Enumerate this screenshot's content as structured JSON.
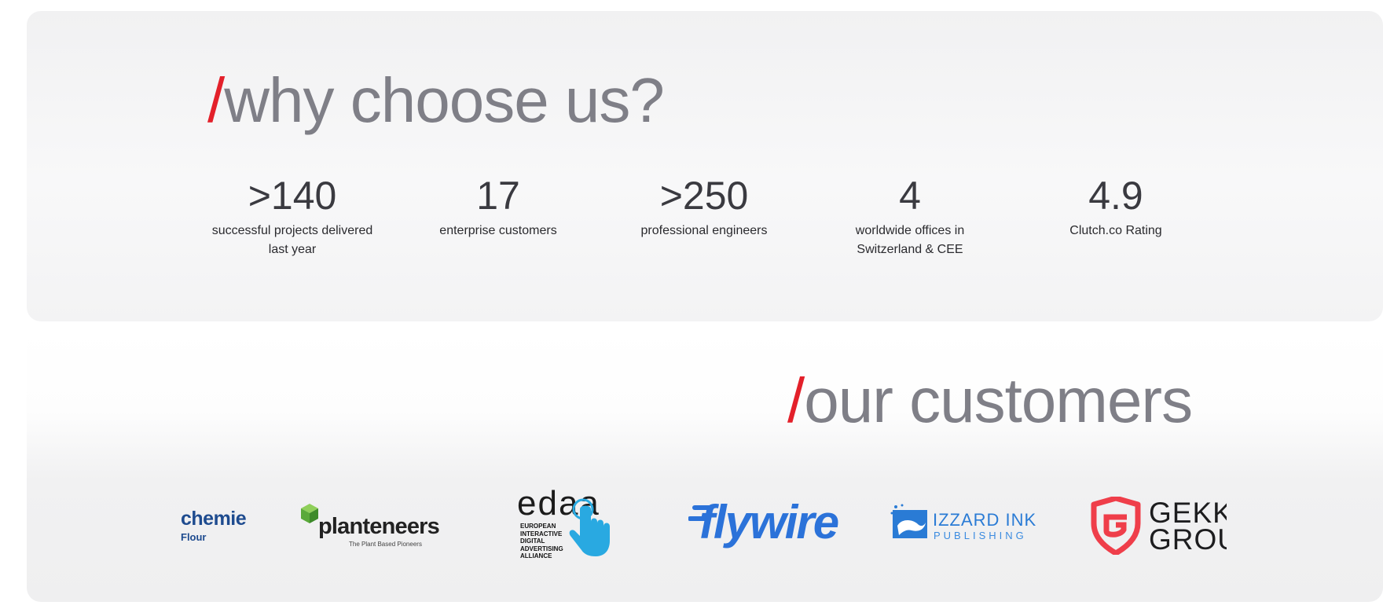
{
  "why": {
    "slash": "/",
    "title": "why choose us?"
  },
  "stats": [
    {
      "value": ">140",
      "label_line1": "successful projects delivered",
      "label_line2": "last year"
    },
    {
      "value": "17",
      "label_line1": "enterprise customers",
      "label_line2": ""
    },
    {
      "value": ">250",
      "label_line1": "professional engineers",
      "label_line2": ""
    },
    {
      "value": "4",
      "label_line1": "worldwide offices in",
      "label_line2": "Switzerland & CEE"
    },
    {
      "value": "4.9",
      "label_line1": "Clutch.co Rating",
      "label_line2": ""
    }
  ],
  "customers": {
    "slash": "/",
    "title": "our customers",
    "logos": [
      {
        "name": "chemie",
        "text": "chemie",
        "subtext": "Flour",
        "icon": "chemie-logo",
        "color": "#1e4b8f"
      },
      {
        "name": "planteneers",
        "text": "planteneers",
        "subtext": "The Plant Based Pioneers",
        "icon": "leaf-cube-logo",
        "color": "#6dbb45"
      },
      {
        "name": "edaa",
        "text": "edaa",
        "subtext": "EUROPEAN INTERACTIVE DIGITAL ADVERTISING ALLIANCE",
        "subtext_lines": [
          "EUROPEAN",
          "INTERACTIVE",
          "DIGITAL",
          "ADVERTISING",
          "ALLIANCE"
        ],
        "icon": "pointing-hand-icon",
        "color": "#29a9e1"
      },
      {
        "name": "flywire",
        "text": "flywire",
        "icon": "flywire-logo",
        "color": "#2b72d9"
      },
      {
        "name": "izzard-ink",
        "text": "IZZARD INK",
        "subtext": "PUBLISHING",
        "icon": "lizard-icon",
        "color": "#2a7bd5"
      },
      {
        "name": "gekko-group",
        "text": "GEKKO",
        "subtext": "GROUP",
        "icon": "shield-g-icon",
        "color": "#ef3e4a"
      }
    ]
  },
  "colors": {
    "accent_red": "#e3202a",
    "heading_gray": "#7f7f87",
    "card_bg": "#f1f1f2"
  }
}
